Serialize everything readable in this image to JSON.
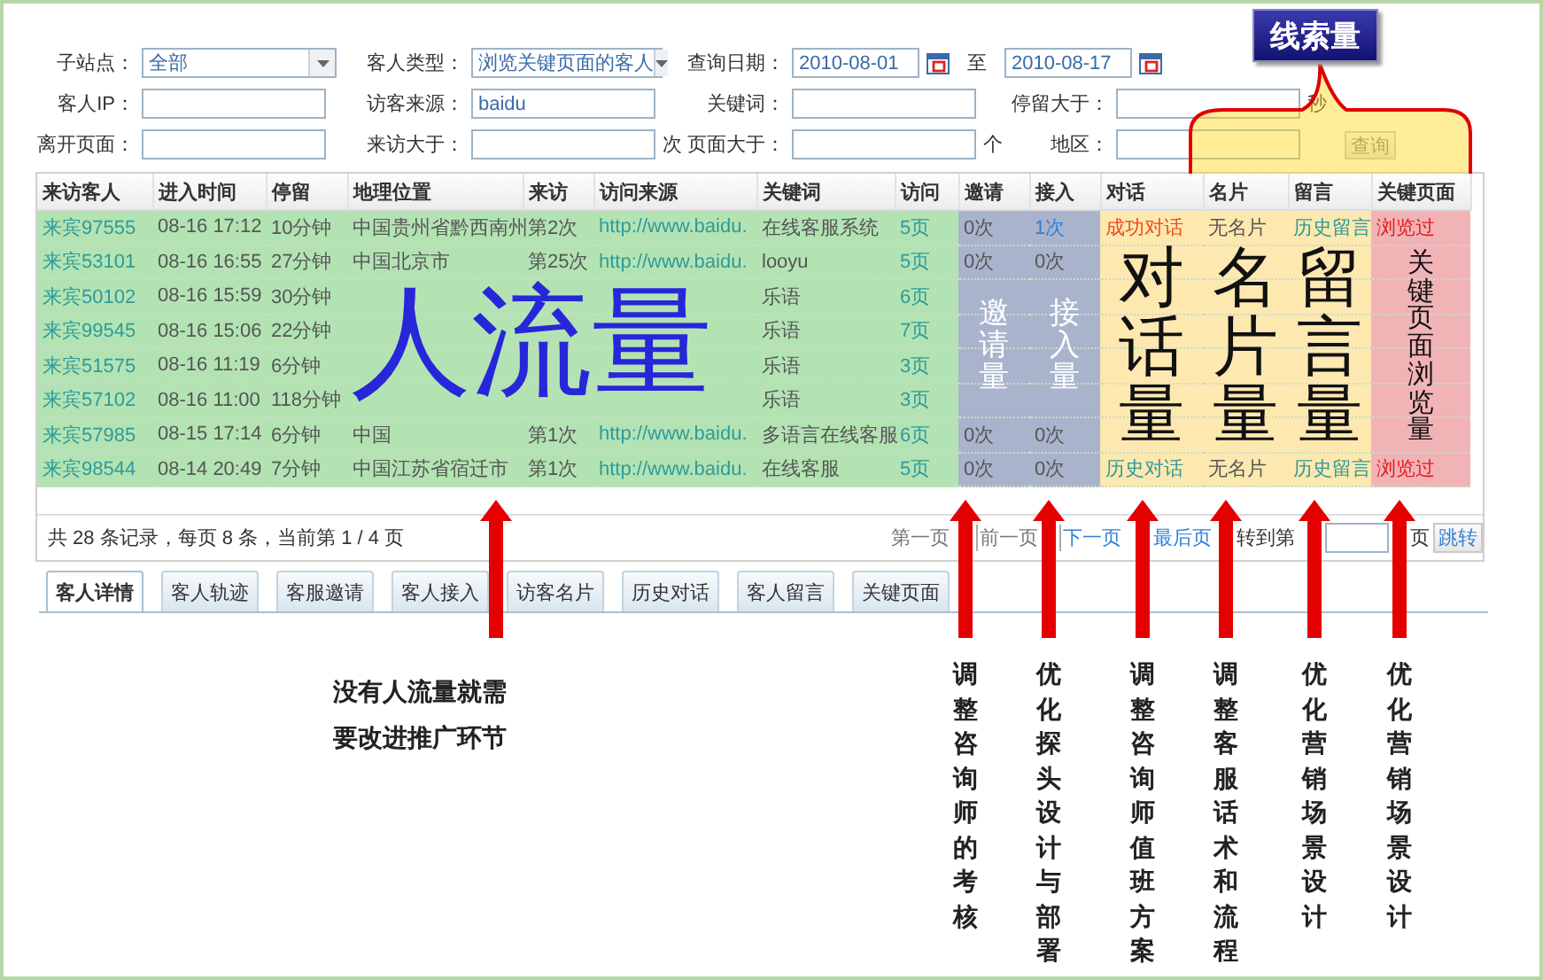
{
  "filters": [
    [
      {
        "label": "子站点：",
        "kind": "select",
        "value": "全部"
      },
      {
        "label": "客人类型：",
        "kind": "select",
        "value": "浏览关键页面的客人"
      },
      {
        "label": "查询日期：",
        "kind": "daterange",
        "from": "2010-08-01",
        "separator": "至",
        "to": "2010-08-17"
      }
    ],
    [
      {
        "label": "客人IP：",
        "kind": "text"
      },
      {
        "label": "访客来源：",
        "kind": "text",
        "value": "baidu"
      },
      {
        "label": "关键词：",
        "kind": "text"
      },
      {
        "label": "停留大于：",
        "kind": "text",
        "unit": "秒"
      }
    ],
    [
      {
        "label": "离开页面：",
        "kind": "text"
      },
      {
        "label": "来访大于：",
        "kind": "text",
        "unit": "次"
      },
      {
        "label": "页面大于：",
        "kind": "text",
        "unit": "个"
      },
      {
        "label": "地区：",
        "kind": "text"
      }
    ]
  ],
  "search_button": "查询",
  "callout": {
    "label": "线索量"
  },
  "traffic": {
    "label": "人流量",
    "advice": "没有人流量就需要改进推广环节"
  },
  "table": {
    "columns": [
      {
        "label": "来访客人",
        "kind": "link",
        "color": "#b3e3b3"
      },
      {
        "label": "进入时间",
        "kind": "text",
        "color": "#b3e3b3"
      },
      {
        "label": "停留",
        "kind": "text",
        "color": "#b3e3b3"
      },
      {
        "label": "地理位置",
        "kind": "text",
        "color": "#b3e3b3"
      },
      {
        "label": "来访",
        "kind": "text",
        "color": "#b3e3b3"
      },
      {
        "label": "访问来源",
        "kind": "link",
        "color": "#b3e3b3"
      },
      {
        "label": "关键词",
        "kind": "text",
        "color": "#b3e3b3"
      },
      {
        "label": "访问",
        "kind": "link",
        "color": "#b3e3b3"
      },
      {
        "label": "邀请",
        "kind": "text",
        "color": "#a9b4cc",
        "overlay": {
          "text": "邀请量",
          "kind": "light"
        },
        "advice": "调整咨询师的考核"
      },
      {
        "label": "接入",
        "kind": "text",
        "color": "#a9b4cc",
        "overlay": {
          "text": "接入量",
          "kind": "light"
        },
        "advice": "优化探头设计与部署"
      },
      {
        "label": "对话",
        "kind": "link",
        "color": "#fde8b0",
        "overlay": {
          "text": "对话量",
          "kind": "dark"
        },
        "advice": "调整咨询师值班方案"
      },
      {
        "label": "名片",
        "kind": "text",
        "color": "#fde8b0",
        "overlay": {
          "text": "名片量",
          "kind": "dark"
        },
        "advice": "调整客服话术和流程"
      },
      {
        "label": "留言",
        "kind": "link",
        "color": "#fde8b0",
        "overlay": {
          "text": "留言量",
          "kind": "dark"
        },
        "advice": "优化营销场景设计"
      },
      {
        "label": "关键页面",
        "kind": "alert",
        "color": "#f2b3b6",
        "overlay": {
          "text": "关键页面浏览量",
          "kind": "dark"
        },
        "advice": "优化营销场景设计"
      }
    ],
    "rows": [
      {
        "cells": [
          "来宾97555",
          "08-16 17:12",
          "10分钟",
          "中国贵州省黔西南州",
          "第2次",
          "http://www.baidu.",
          "在线客服系统",
          "5页",
          "0次",
          {
            "text": "1次",
            "emphasis": true
          },
          {
            "text": "成功对话",
            "emphasis": true
          },
          "无名片",
          "历史留言",
          "浏览过"
        ]
      },
      {
        "cells": [
          "来宾53101",
          "08-16 16:55",
          "27分钟",
          "中国北京市",
          "第25次",
          "http://www.baidu.",
          "looyu",
          "5页",
          "0次",
          "0次",
          null,
          null,
          null,
          null
        ]
      },
      {
        "cells": [
          "来宾50102",
          "08-16 15:59",
          "30分钟",
          null,
          null,
          null,
          "乐语",
          "6页",
          null,
          null,
          null,
          null,
          null,
          null
        ]
      },
      {
        "cells": [
          "来宾99545",
          "08-16 15:06",
          "22分钟",
          null,
          null,
          null,
          "乐语",
          "7页",
          null,
          null,
          null,
          null,
          null,
          null
        ]
      },
      {
        "cells": [
          "来宾51575",
          "08-16 11:19",
          "6分钟",
          null,
          null,
          null,
          "乐语",
          "3页",
          null,
          null,
          null,
          null,
          null,
          null
        ]
      },
      {
        "cells": [
          "来宾57102",
          "08-16 11:00",
          "118分钟",
          null,
          null,
          null,
          "乐语",
          "3页",
          null,
          null,
          null,
          null,
          null,
          null
        ]
      },
      {
        "cells": [
          "来宾57985",
          "08-15 17:14",
          "6分钟",
          "中国",
          "第1次",
          "http://www.baidu.",
          "多语言在线客服",
          "6页",
          "0次",
          "0次",
          null,
          null,
          null,
          null
        ]
      },
      {
        "cells": [
          "来宾98544",
          "08-14 20:49",
          "7分钟",
          "中国江苏省宿迁市",
          "第1次",
          "http://www.baidu.",
          "在线客服",
          "5页",
          "0次",
          {
            "text": "0次",
            "emphasis": false
          },
          {
            "text": "历史对话",
            "emphasis": false
          },
          "无名片",
          "历史留言",
          "浏览过"
        ]
      }
    ]
  },
  "pagination": {
    "summary": "共 28 条记录，每页 8 条，当前第 1 / 4 页",
    "links": [
      {
        "label": "第一页",
        "disabled": true
      },
      {
        "label": "前一页",
        "disabled": true
      },
      {
        "label": "下一页",
        "disabled": false
      },
      {
        "label": "最后页",
        "disabled": false
      }
    ],
    "goto_label": "转到第",
    "goto_unit": "页",
    "goto_button": "跳转"
  },
  "tabs": [
    {
      "label": "客人详情",
      "selected": true
    },
    {
      "label": "客人轨迹",
      "selected": false
    },
    {
      "label": "客服邀请",
      "selected": false
    },
    {
      "label": "客人接入",
      "selected": false
    },
    {
      "label": "访客名片",
      "selected": false
    },
    {
      "label": "历史对话",
      "selected": false
    },
    {
      "label": "客人留言",
      "selected": false
    },
    {
      "label": "关键页面",
      "selected": false
    }
  ]
}
